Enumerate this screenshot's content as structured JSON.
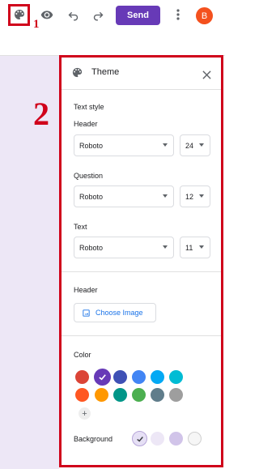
{
  "annotations": {
    "label_1": "1",
    "label_2": "2"
  },
  "toolbar": {
    "palette_icon": "palette-icon",
    "preview_icon": "eye-icon",
    "undo_icon": "undo-icon",
    "redo_icon": "redo-icon",
    "send_label": "Send",
    "more_icon": "more-vert-icon",
    "avatar_letter": "B"
  },
  "theme_panel": {
    "title": "Theme",
    "text_style": {
      "section_title": "Text style",
      "header": {
        "label": "Header",
        "font": "Roboto",
        "size": "24"
      },
      "question": {
        "label": "Question",
        "font": "Roboto",
        "size": "12"
      },
      "text": {
        "label": "Text",
        "font": "Roboto",
        "size": "11"
      }
    },
    "header_section": {
      "label": "Header",
      "choose_image_label": "Choose Image"
    },
    "color_section": {
      "label": "Color",
      "swatches_row1": [
        "#db4437",
        "#673ab7",
        "#3f51b5",
        "#4285f4",
        "#03a9f4",
        "#00bcd4"
      ],
      "swatches_row2": [
        "#ff5722",
        "#ff9800",
        "#009688",
        "#4caf50",
        "#607d8b",
        "#9e9e9e"
      ],
      "selected_swatch": "#673ab7",
      "add_label": "+"
    },
    "background": {
      "label": "Background",
      "swatches": [
        "#e6e0f5",
        "#ede7f6",
        "#d1c4e9",
        "#f6f6f6"
      ],
      "selected_index": 0
    }
  }
}
